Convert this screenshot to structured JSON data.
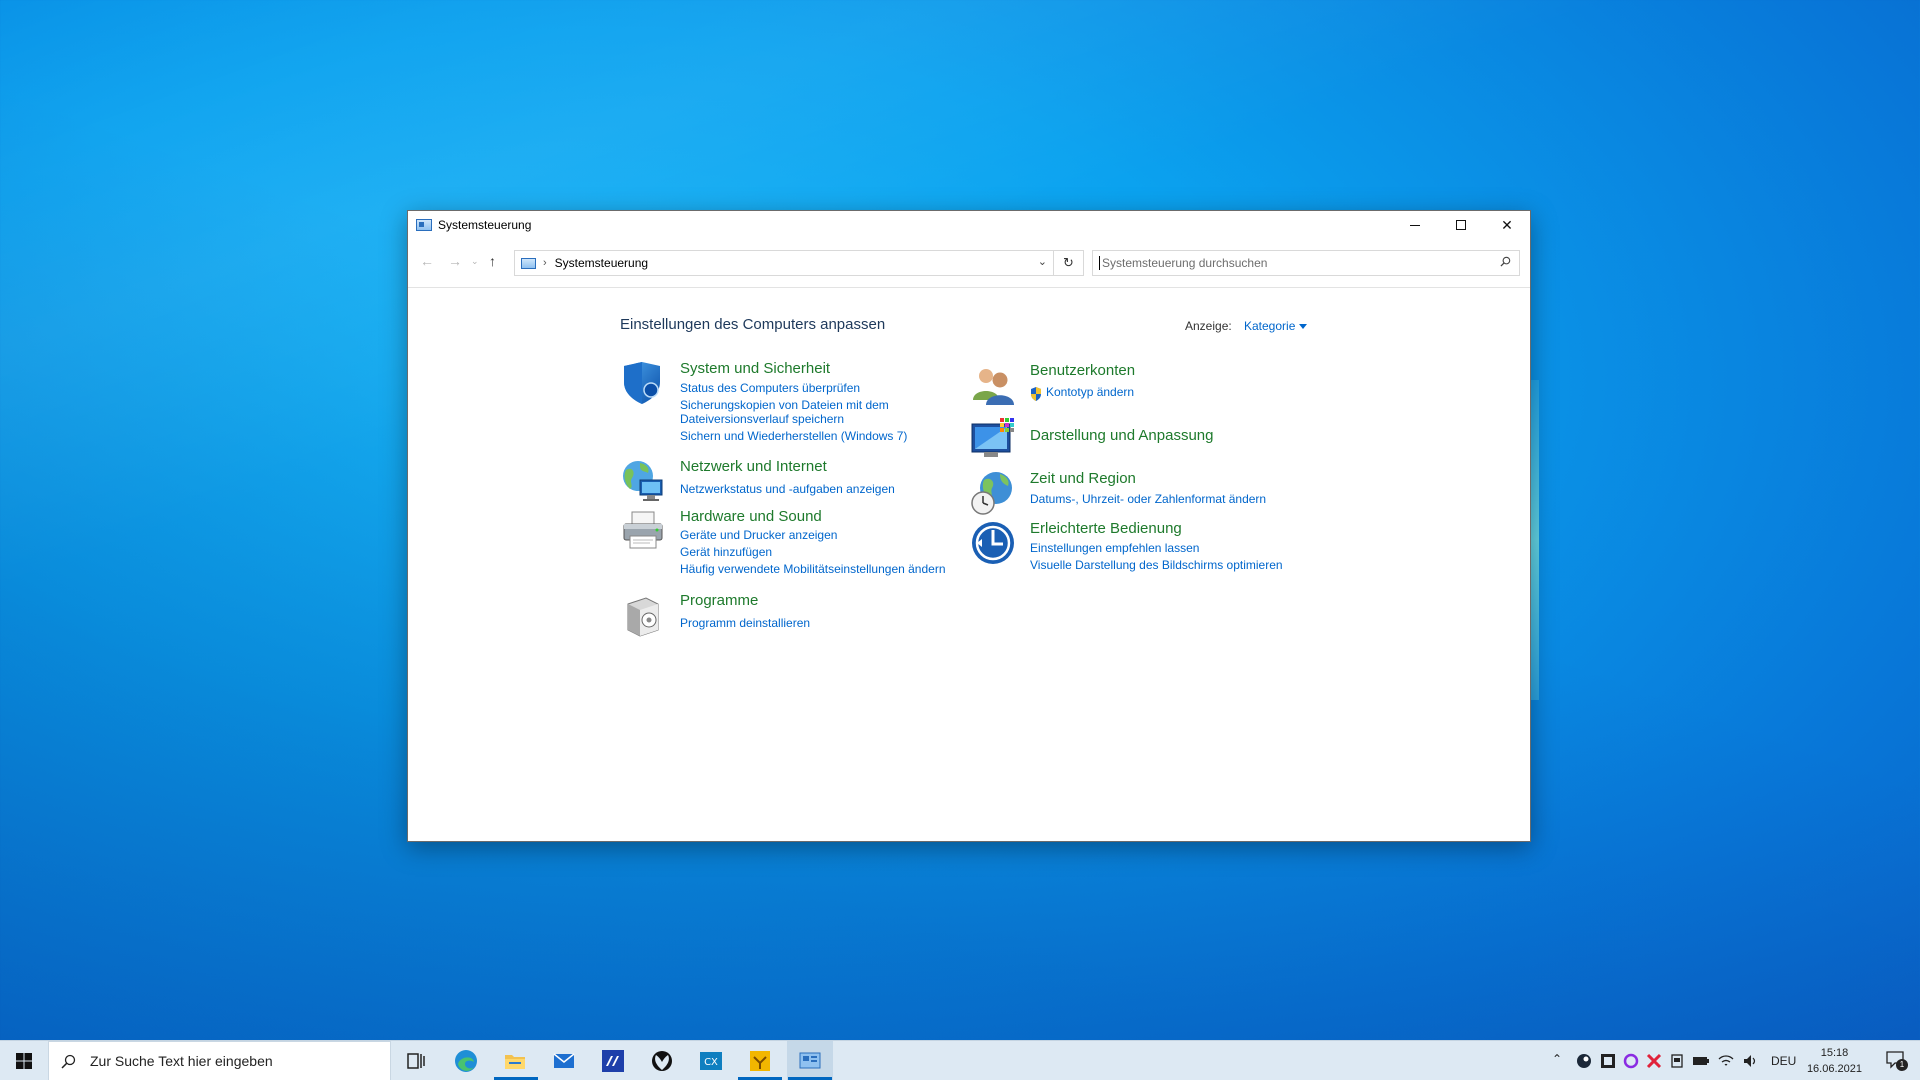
{
  "window": {
    "title": "Systemsteuerung",
    "address": "Systemsteuerung",
    "search_placeholder": "Systemsteuerung durchsuchen"
  },
  "content": {
    "heading": "Einstellungen des Computers anpassen",
    "view_by_label": "Anzeige:",
    "view_by_value": "Kategorie",
    "categories_left": [
      {
        "title": "System und Sicherheit",
        "links": [
          "Status des Computers überprüfen",
          "Sicherungskopien von Dateien mit dem",
          "Dateiversionsverlauf speichern",
          "Sichern und Wiederherstellen (Windows 7)"
        ]
      },
      {
        "title": "Netzwerk und Internet",
        "links": [
          "Netzwerkstatus und -aufgaben anzeigen"
        ]
      },
      {
        "title": "Hardware und Sound",
        "links": [
          "Geräte und Drucker anzeigen",
          "Gerät hinzufügen",
          "Häufig verwendete Mobilitätseinstellungen ändern"
        ]
      },
      {
        "title": "Programme",
        "links": [
          "Programm deinstallieren"
        ]
      }
    ],
    "categories_right": [
      {
        "title": "Benutzerkonten",
        "links": [
          "Kontotyp ändern"
        ]
      },
      {
        "title": "Darstellung und Anpassung",
        "links": []
      },
      {
        "title": "Zeit und Region",
        "links": [
          "Datums-, Uhrzeit- oder Zahlenformat ändern"
        ]
      },
      {
        "title": "Erleichterte Bedienung",
        "links": [
          "Einstellungen empfehlen lassen",
          "Visuelle Darstellung des Bildschirms optimieren"
        ]
      }
    ]
  },
  "taskbar": {
    "search_placeholder": "Zur Suche Text hier eingeben",
    "language": "DEU",
    "time": "15:18",
    "date": "16.06.2021",
    "notification_count": "1"
  },
  "colors": {
    "category_title": "#1e7a2c",
    "link": "#0066cc",
    "heading": "#1e395b",
    "accent": "#0067c0"
  }
}
